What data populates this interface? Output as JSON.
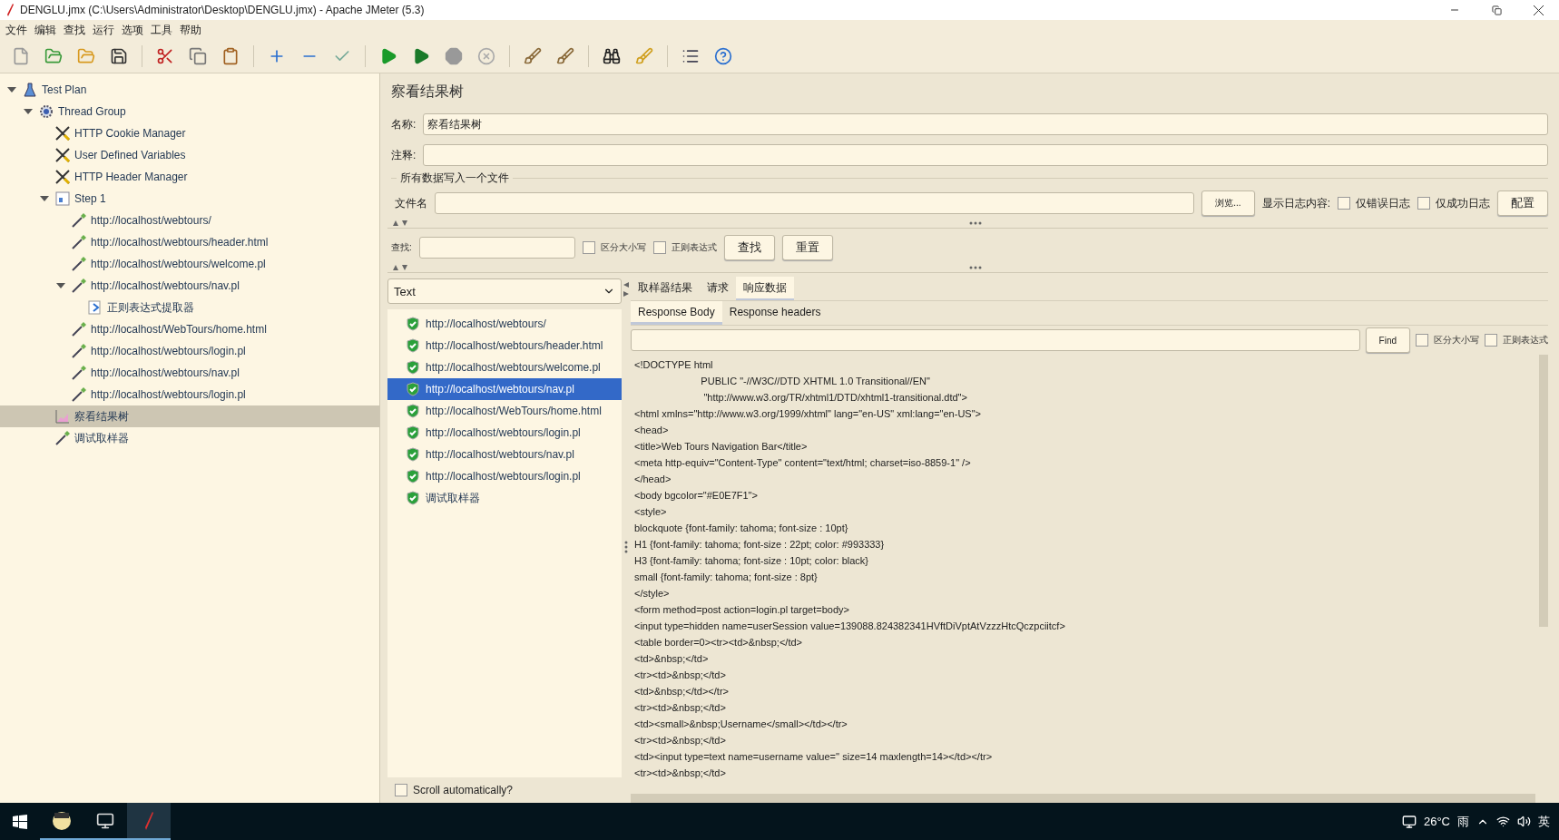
{
  "window": {
    "title": "DENGLU.jmx (C:\\Users\\Administrator\\Desktop\\DENGLU.jmx) - Apache JMeter (5.3)"
  },
  "menu": [
    "文件",
    "编辑",
    "查找",
    "运行",
    "选项",
    "工具",
    "帮助"
  ],
  "tree": [
    {
      "label": "Test Plan",
      "kind": "plan",
      "expanded": true,
      "selected": false,
      "children": [
        {
          "label": "Thread Group",
          "kind": "threads",
          "expanded": true,
          "selected": false,
          "children": [
            {
              "label": "HTTP Cookie Manager",
              "kind": "config",
              "selected": false
            },
            {
              "label": "User Defined Variables",
              "kind": "config",
              "selected": false
            },
            {
              "label": "HTTP Header Manager",
              "kind": "config",
              "selected": false
            },
            {
              "label": "Step 1",
              "kind": "controller",
              "expanded": true,
              "selected": false,
              "children": [
                {
                  "label": "http://localhost/webtours/",
                  "kind": "sampler",
                  "selected": false
                },
                {
                  "label": "http://localhost/webtours/header.html",
                  "kind": "sampler",
                  "selected": false
                },
                {
                  "label": "http://localhost/webtours/welcome.pl",
                  "kind": "sampler",
                  "selected": false
                },
                {
                  "label": "http://localhost/webtours/nav.pl",
                  "kind": "sampler",
                  "expanded": true,
                  "selected": false,
                  "children": [
                    {
                      "label": "正则表达式提取器",
                      "kind": "extractor",
                      "selected": false
                    }
                  ]
                },
                {
                  "label": "http://localhost/WebTours/home.html",
                  "kind": "sampler",
                  "selected": false
                },
                {
                  "label": "http://localhost/webtours/login.pl",
                  "kind": "sampler",
                  "selected": false
                },
                {
                  "label": "http://localhost/webtours/nav.pl",
                  "kind": "sampler",
                  "selected": false
                },
                {
                  "label": "http://localhost/webtours/login.pl",
                  "kind": "sampler",
                  "selected": false
                }
              ]
            },
            {
              "label": "察看结果树",
              "kind": "listener",
              "selected": true
            },
            {
              "label": "调试取样器",
              "kind": "sampler",
              "selected": false
            }
          ]
        }
      ]
    }
  ],
  "panel": {
    "title": "察看结果树",
    "name_label": "名称:",
    "name_value": "察看结果树",
    "comment_label": "注释:",
    "file_group": "所有数据写入一个文件",
    "file_label": "文件名",
    "browse": "浏览...",
    "log_label": "显示日志内容:",
    "log_options": [
      {
        "label": "仅错误日志",
        "checked": false
      },
      {
        "label": "仅成功日志",
        "checked": false
      }
    ],
    "config_button": "配置",
    "search_label": "查找:",
    "search_options": [
      {
        "label": "区分大小写",
        "checked": false
      },
      {
        "label": "正则表达式",
        "checked": false
      }
    ],
    "search_button": "查找",
    "reset_button": "重置"
  },
  "renderer": "Text",
  "results": [
    {
      "label": "http://localhost/webtours/",
      "selected": false
    },
    {
      "label": "http://localhost/webtours/header.html",
      "selected": false
    },
    {
      "label": "http://localhost/webtours/welcome.pl",
      "selected": false
    },
    {
      "label": "http://localhost/webtours/nav.pl",
      "selected": true
    },
    {
      "label": "http://localhost/WebTours/home.html",
      "selected": false
    },
    {
      "label": "http://localhost/webtours/login.pl",
      "selected": false
    },
    {
      "label": "http://localhost/webtours/nav.pl",
      "selected": false
    },
    {
      "label": "http://localhost/webtours/login.pl",
      "selected": false
    },
    {
      "label": "调试取样器",
      "selected": false
    }
  ],
  "scroll_auto": {
    "label": "Scroll automatically?",
    "checked": false
  },
  "tabs": [
    {
      "label": "取样器结果",
      "selected": false
    },
    {
      "label": "请求",
      "selected": false
    },
    {
      "label": "响应数据",
      "selected": true
    }
  ],
  "subtabs": [
    {
      "label": "Response Body",
      "selected": true
    },
    {
      "label": "Response headers",
      "selected": false
    }
  ],
  "find": {
    "button": "Find",
    "options": [
      {
        "label": "区分大小写",
        "checked": false
      },
      {
        "label": "正则表达式",
        "checked": false
      }
    ]
  },
  "response_lines": [
    "<!DOCTYPE html",
    "                        PUBLIC \"-//W3C//DTD XHTML 1.0 Transitional//EN\"",
    "                         \"http://www.w3.org/TR/xhtml1/DTD/xhtml1-transitional.dtd\">",
    "<html xmlns=\"http://www.w3.org/1999/xhtml\" lang=\"en-US\" xml:lang=\"en-US\">",
    "<head>",
    "<title>Web Tours Navigation Bar</title>",
    "<meta http-equiv=\"Content-Type\" content=\"text/html; charset=iso-8859-1\" />",
    "</head>",
    "<body bgcolor=\"#E0E7F1\">",
    "<style>",
    "blockquote {font-family: tahoma; font-size : 10pt}",
    "H1 {font-family: tahoma; font-size : 22pt; color: #993333}",
    "H3 {font-family: tahoma; font-size : 10pt; color: black}",
    "small {font-family: tahoma; font-size : 8pt}",
    "</style>",
    "<form method=post action=login.pl target=body>",
    "<input type=hidden name=userSession value=139088.824382341HVftDiVptAtVzzzHtcQczpciitcf>",
    "<table border=0><tr><td>&nbsp;</td>",
    "<td>&nbsp;</td>",
    "<tr><td>&nbsp;</td>",
    "<td>&nbsp;</td></tr>",
    "<tr><td>&nbsp;</td>",
    "<td><small>&nbsp;Username</small></td></tr>",
    "<tr><td>&nbsp;</td>",
    "<td><input type=text name=username value='' size=14 maxlength=14></td></tr>",
    "<tr><td>&nbsp;</td>"
  ],
  "taskbar": {
    "temperature": "26°C",
    "weather": "雨",
    "ime": "英"
  }
}
